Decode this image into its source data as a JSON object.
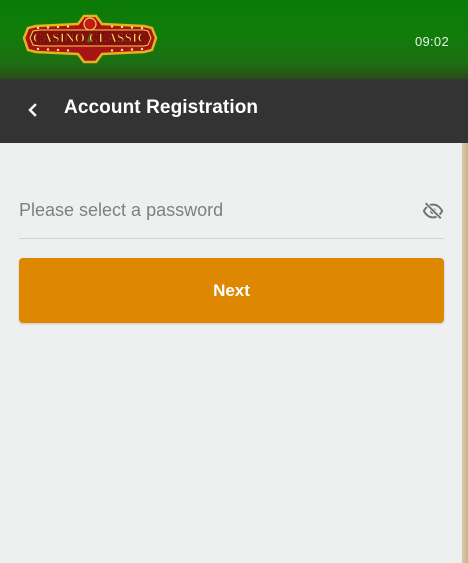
{
  "header": {
    "logo_text": "CASINO CLASSIC",
    "time": "09:02",
    "brand_color": "#0f7c09"
  },
  "titlebar": {
    "back_icon": "chevron-left-icon",
    "title": "Account Registration"
  },
  "form": {
    "password": {
      "placeholder": "Please select a password",
      "value": "",
      "visibility_icon": "eye-off-icon"
    },
    "next_label": "Next",
    "accent_color": "#dd8800"
  }
}
